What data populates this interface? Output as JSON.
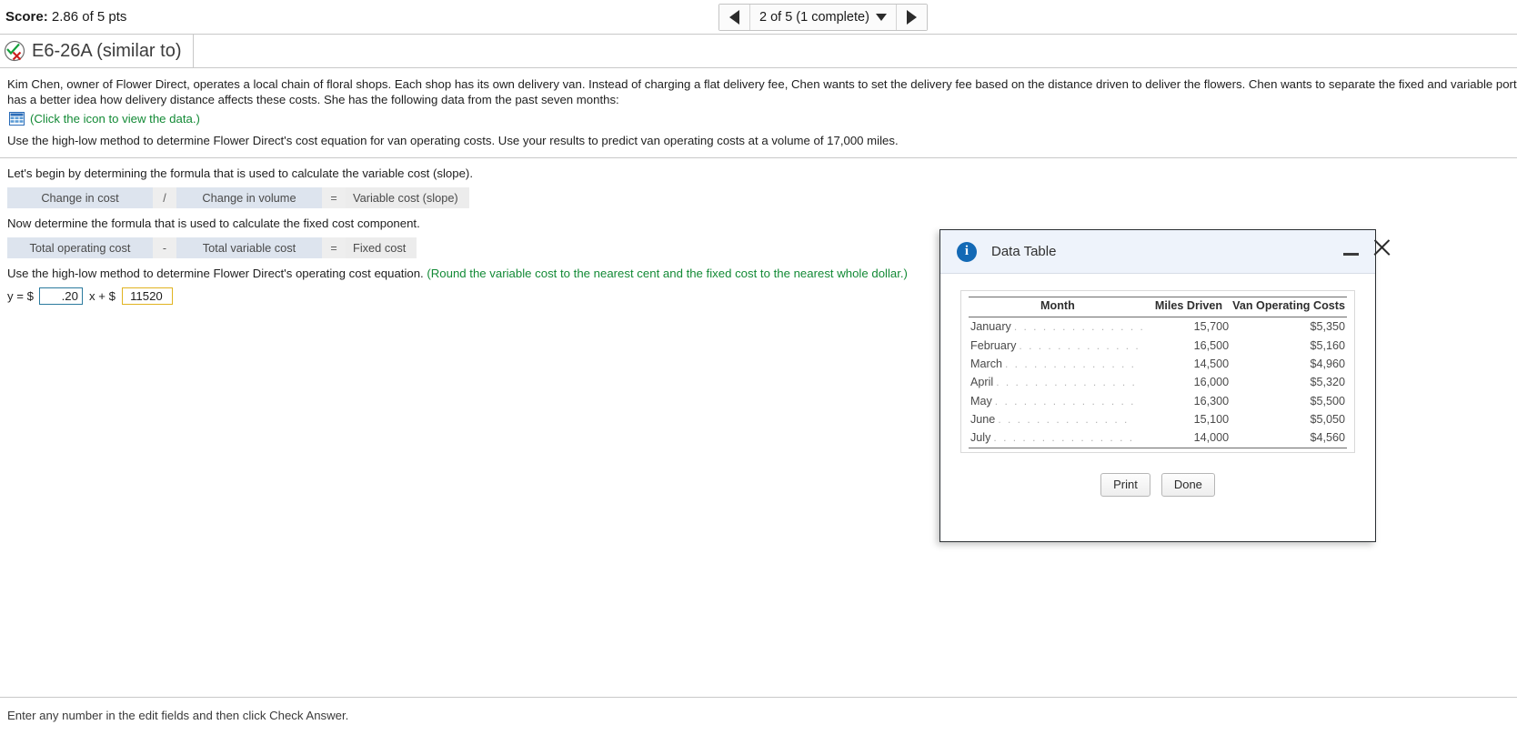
{
  "score": {
    "label": "Score:",
    "value": "2.86 of 5 pts"
  },
  "pager": {
    "prev_icon": "triangle-left-icon",
    "next_icon": "triangle-right-icon",
    "label": "2 of 5 (1 complete)",
    "caret_icon": "caret-down-icon"
  },
  "question": {
    "icon": "check-x-status-icon",
    "title": "E6-26A (similar to)"
  },
  "problem": {
    "line1": "Kim Chen, owner of Flower Direct, operates a local chain of floral shops. Each shop has its own delivery van. Instead of charging a flat delivery fee, Chen wants to set the delivery fee based on the distance driven to deliver the flowers. Chen wants to separate the fixed and variable portions",
    "line2": "has a better idea how delivery distance affects these costs. She has the following data from the past seven months:",
    "data_icon": "spreadsheet-icon",
    "data_link": "(Click the icon to view the data.)",
    "instruction": "Use the high-low method to determine Flower Direct's cost equation for van operating costs. Use your results to predict van operating costs at a volume of 17,000 miles."
  },
  "step1": {
    "prompt": "Let's begin by determining the formula that is used to calculate the variable cost (slope).",
    "term1": "Change in cost",
    "operator": "/",
    "term2": "Change in volume",
    "equals": "=",
    "result": "Variable cost (slope)"
  },
  "step2": {
    "prompt": "Now determine the formula that is used to calculate the fixed cost component.",
    "term1": "Total operating cost",
    "operator": "-",
    "term2": "Total variable cost",
    "equals": "=",
    "result": "Fixed cost"
  },
  "step3": {
    "prompt": "Use the high-low method to determine Flower Direct's operating cost equation.",
    "rounding_note": "(Round the variable cost to the nearest cent and the fixed cost to the nearest whole dollar.)",
    "eq_lead": "y = $",
    "slope_value": ".20",
    "eq_mid": "x + $",
    "intercept_value": "11520"
  },
  "footer": {
    "hint": "Enter any number in the edit fields and then click Check Answer."
  },
  "dialog": {
    "title": "Data Table",
    "info_icon": "info-circle-icon",
    "minimize_icon": "minimize-icon",
    "close_icon": "close-icon",
    "columns": [
      "Month",
      "Miles Driven",
      "Van Operating Costs"
    ],
    "rows": [
      {
        "month": "January",
        "miles": "15,700",
        "cost": "$5,350"
      },
      {
        "month": "February",
        "miles": "16,500",
        "cost": "$5,160"
      },
      {
        "month": "March",
        "miles": "14,500",
        "cost": "$4,960"
      },
      {
        "month": "April",
        "miles": "16,000",
        "cost": "$5,320"
      },
      {
        "month": "May",
        "miles": "16,300",
        "cost": "$5,500"
      },
      {
        "month": "June",
        "miles": "15,100",
        "cost": "$5,050"
      },
      {
        "month": "July",
        "miles": "14,000",
        "cost": "$4,560"
      }
    ],
    "print_label": "Print",
    "done_label": "Done"
  },
  "colors": {
    "green_link": "#138a36",
    "info_blue": "#1369b5",
    "formula_cell": "#dde4ee",
    "input_blue_border": "#2b7a9e",
    "input_yellow_border": "#e0b320"
  }
}
